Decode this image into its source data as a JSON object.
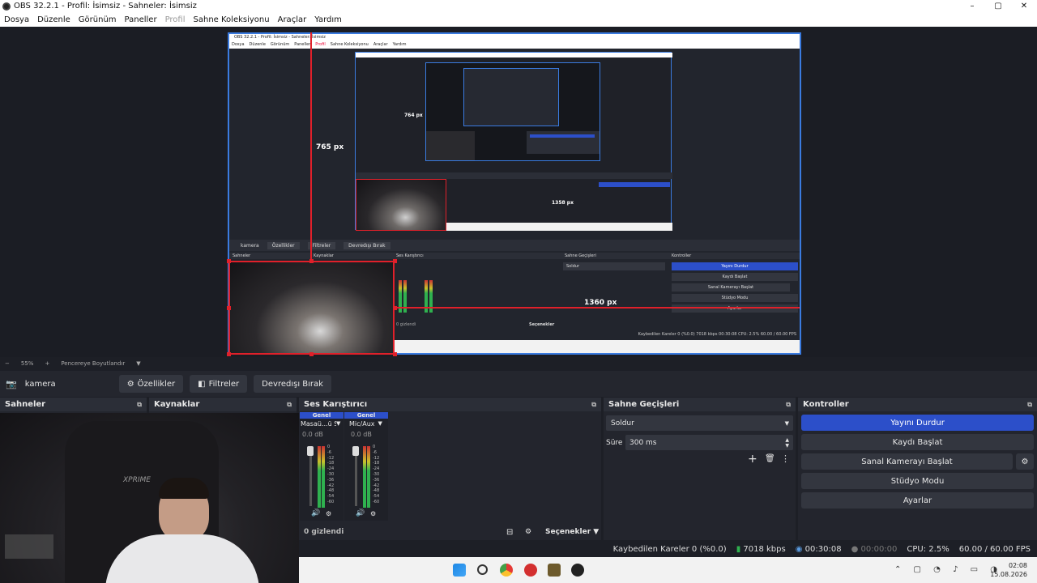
{
  "window": {
    "title": "OBS 32.2.1 - Profil: İsimsiz - Sahneler: İsimsiz",
    "buttons": [
      "–",
      "▢",
      "✕"
    ]
  },
  "menu": {
    "items": [
      "Dosya",
      "Düzenle",
      "Görünüm",
      "Paneller",
      "Profil",
      "Sahne Koleksiyonu",
      "Araçlar",
      "Yardım"
    ]
  },
  "preview": {
    "measure_vertical": "765 px",
    "measure_horizontal": "1360 px",
    "nested_measure_vertical": "764 px",
    "nested_measure_horizontal": "1358 px",
    "inner_source_name": "kamera",
    "inner_dock_titles": [
      "Sahneler",
      "Kaynaklar",
      "Ses Karıştırıcı",
      "Sahne Geçişleri",
      "Kontroller"
    ],
    "inner_hidden": "0 gizlendi",
    "inner_options": "Seçenekler"
  },
  "zoombar": {
    "zoom": "55%",
    "mode": "Pencereye Boyutlandır"
  },
  "source_toolbar": {
    "source_name": "kamera",
    "properties": "Özellikler",
    "filters": "Filtreler",
    "deactivate": "Devredışı Bırak"
  },
  "docks": {
    "scenes": {
      "title": "Sahneler"
    },
    "sources": {
      "title": "Kaynaklar"
    },
    "mixer": {
      "title": "Ses Karıştırıcı",
      "channels": [
        {
          "group": "Genel",
          "name": "Masaü...ü Ses",
          "db": "0.0 dB"
        },
        {
          "group": "Genel",
          "name": "Mic/Aux",
          "db": "0.0 dB"
        }
      ],
      "scale": [
        "0",
        "-6",
        "-12",
        "-18",
        "-24",
        "-30",
        "-36",
        "-42",
        "-48",
        "-54",
        "-60"
      ],
      "hidden": "0 gizlendi",
      "options": "Seçenekler"
    },
    "transitions": {
      "title": "Sahne Geçişleri",
      "selected": "Soldur",
      "duration_label": "Süre",
      "duration_value": "300 ms"
    },
    "controls": {
      "title": "Kontroller",
      "buttons": [
        "Yayını Durdur",
        "Kaydı Başlat",
        "Sanal Kamerayı Başlat",
        "Stüdyo Modu",
        "Ayarlar"
      ]
    }
  },
  "status": {
    "dropped": "Kaybedilen Kareler 0 (%0.0)",
    "bitrate": "7018 kbps",
    "stream_time": "00:30:08",
    "rec_time": "00:00:00",
    "cpu": "CPU: 2.5%",
    "fps": "60.00 / 60.00 FPS"
  },
  "taskbar": {
    "time": "02:08",
    "date": "15.08.2026"
  },
  "colors": {
    "accent": "#2c4fc9",
    "selection_red": "#e0202a",
    "preview_border": "#3a7be0"
  }
}
